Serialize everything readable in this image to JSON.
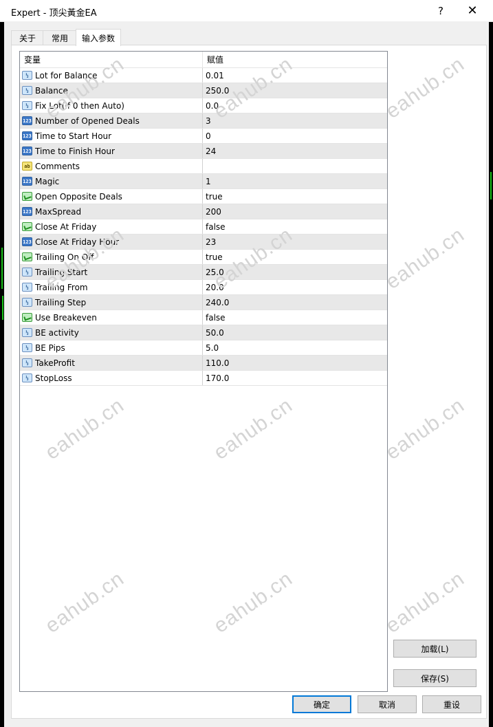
{
  "window": {
    "title": "Expert - 顶尖黃金EA",
    "help_glyph": "?",
    "close_glyph": "✕"
  },
  "tabs": [
    {
      "label": "关于",
      "active": false
    },
    {
      "label": "常用",
      "active": false
    },
    {
      "label": "输入参数",
      "active": true
    }
  ],
  "grid": {
    "columns": {
      "name": "变量",
      "value": "赋值"
    },
    "rows": [
      {
        "name": "Lot for Balance",
        "value": "0.01",
        "icon": "double-type-icon"
      },
      {
        "name": "Balance",
        "value": "250.0",
        "icon": "double-type-icon"
      },
      {
        "name": "Fix Lot(if 0 then Auto)",
        "value": "0.0",
        "icon": "double-type-icon"
      },
      {
        "name": "Number of Opened Deals",
        "value": "3",
        "icon": "integer-type-icon"
      },
      {
        "name": "Time to Start Hour",
        "value": "0",
        "icon": "integer-type-icon"
      },
      {
        "name": "Time to Finish Hour",
        "value": "24",
        "icon": "integer-type-icon"
      },
      {
        "name": "Comments",
        "value": "",
        "icon": "string-type-icon"
      },
      {
        "name": "Magic",
        "value": "1",
        "icon": "integer-type-icon"
      },
      {
        "name": "Open Opposite Deals",
        "value": "true",
        "icon": "bool-type-icon"
      },
      {
        "name": "MaxSpread",
        "value": "200",
        "icon": "integer-type-icon"
      },
      {
        "name": "Close At Friday",
        "value": "false",
        "icon": "bool-type-icon"
      },
      {
        "name": "Close At Friday Hour",
        "value": "23",
        "icon": "integer-type-icon"
      },
      {
        "name": "Trailing On Off",
        "value": "true",
        "icon": "bool-type-icon"
      },
      {
        "name": "Trailing Start",
        "value": "25.0",
        "icon": "double-type-icon"
      },
      {
        "name": "Trailing From",
        "value": "20.0",
        "icon": "double-type-icon"
      },
      {
        "name": "Trailing Step",
        "value": "240.0",
        "icon": "double-type-icon"
      },
      {
        "name": "Use Breakeven",
        "value": "false",
        "icon": "bool-type-icon"
      },
      {
        "name": "BE activity",
        "value": "50.0",
        "icon": "double-type-icon"
      },
      {
        "name": "BE Pips",
        "value": "5.0",
        "icon": "double-type-icon"
      },
      {
        "name": "TakeProfit",
        "value": "110.0",
        "icon": "double-type-icon"
      },
      {
        "name": "StopLoss",
        "value": "170.0",
        "icon": "double-type-icon"
      }
    ]
  },
  "icon_glyphs": {
    "double": "½",
    "integer": "123",
    "string": "ab"
  },
  "buttons": {
    "load": "加载(L)",
    "save": "保存(S)",
    "ok": "确定",
    "cancel": "取消",
    "reset": "重设"
  },
  "watermark": "eahub.cn"
}
